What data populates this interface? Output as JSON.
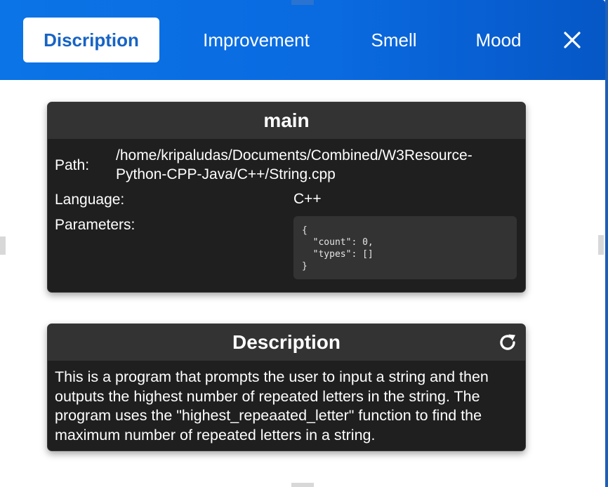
{
  "tabs": [
    {
      "label": "Discription",
      "active": true
    },
    {
      "label": "Improvement",
      "active": false
    },
    {
      "label": "Smell",
      "active": false
    },
    {
      "label": "Mood",
      "active": false
    }
  ],
  "close_icon": "close-icon",
  "main_card": {
    "title": "main",
    "path_label": "Path:",
    "path_value_line1": "/home/kripaludas/Documents/Combined/W3Resource-",
    "path_value_line2": "Python-CPP-Java/C++/String.cpp",
    "language_label": "Language:",
    "language_value": "C++",
    "parameters_label": "Parameters:",
    "parameters_code": "{\n  \"count\": 0,\n  \"types\": []\n}"
  },
  "description_card": {
    "title": "Description",
    "refresh_icon": "refresh-icon",
    "text": "This is a program that prompts the user to input a string and then outputs the highest number of repeated letters in the string. The program uses the \"highest_repeaated_letter\" function to find the maximum number of repeated letters in a string."
  },
  "colors": {
    "header": "#0a6ae0",
    "active_tab_text": "#1763c4",
    "card_bg": "#1f1f1f",
    "card_header_bg": "#333333"
  }
}
